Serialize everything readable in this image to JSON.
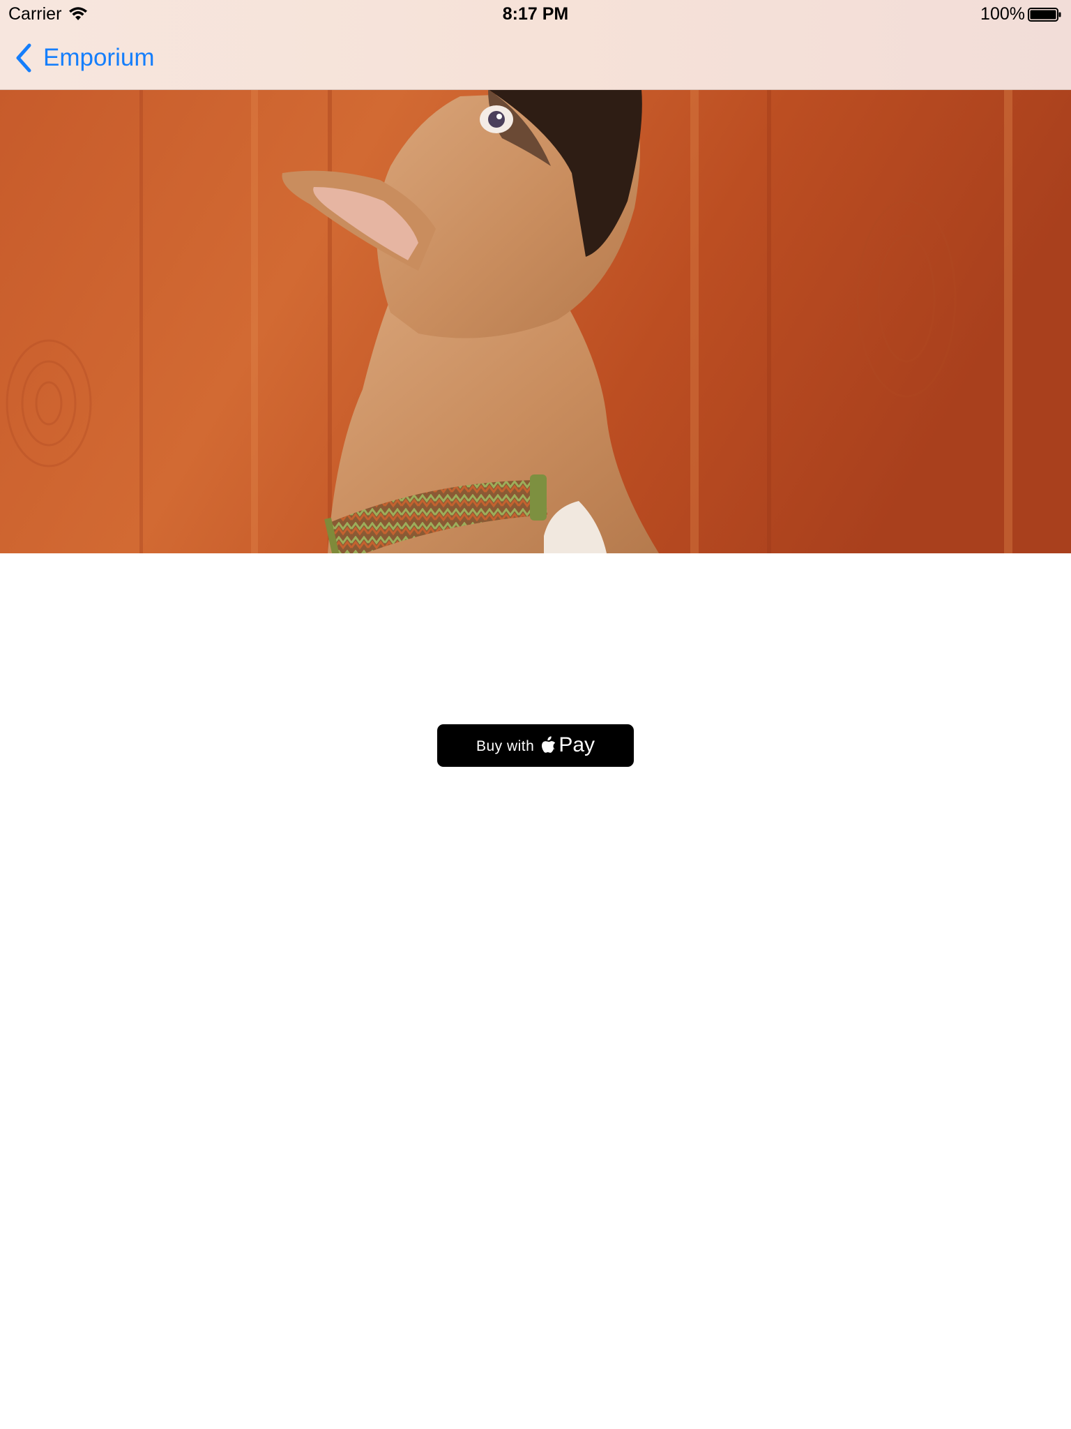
{
  "status_bar": {
    "carrier": "Carrier",
    "time": "8:17 PM",
    "battery": "100%"
  },
  "nav_bar": {
    "back_label": "Emporium"
  },
  "buy_button": {
    "prefix": "Buy with",
    "suffix": "Pay"
  },
  "colors": {
    "tint": "#157efb",
    "button_bg": "#000000",
    "nav_bg": "#f7e4dc"
  },
  "icons": [
    "wifi-icon",
    "battery-icon",
    "back-chevron-icon",
    "apple-logo-icon"
  ]
}
